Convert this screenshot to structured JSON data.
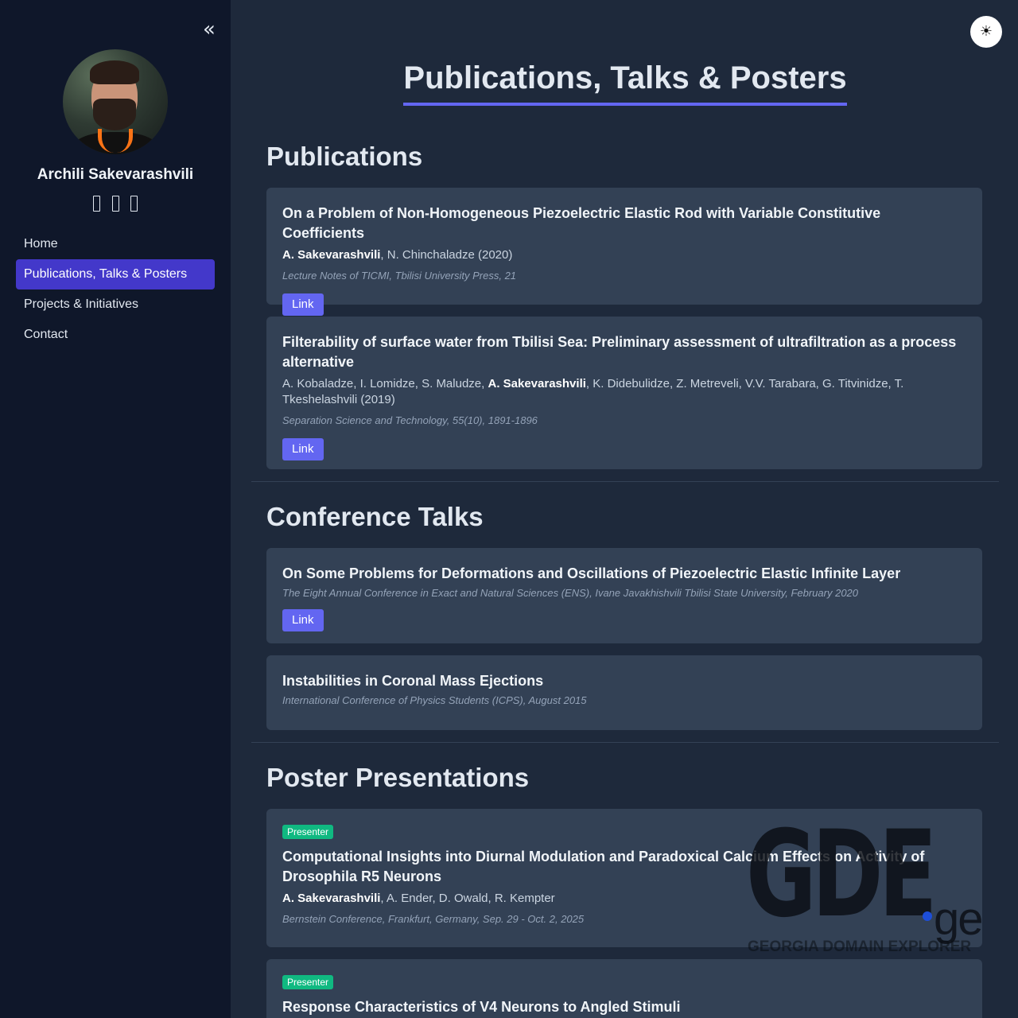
{
  "sidebar": {
    "collapse_icon": "«",
    "name": "Archili Sakevarashvili",
    "nav": [
      {
        "label": "Home",
        "active": false
      },
      {
        "label": "Publications, Talks & Posters",
        "active": true
      },
      {
        "label": "Projects & Initiatives",
        "active": false
      },
      {
        "label": "Contact",
        "active": false
      }
    ]
  },
  "theme_toggle_icon": "☀",
  "page_title": "Publications, Talks & Posters",
  "sections": {
    "publications": {
      "title": "Publications",
      "items": [
        {
          "title": "On a Problem of Non-Homogeneous Piezoelectric Elastic Rod with Variable Constitutive Coefficients",
          "author_bold": "A. Sakevarashvili",
          "authors_rest": ", N. Chinchaladze (2020)",
          "venue": "Lecture Notes of TICMI, Tbilisi University Press, 21",
          "link_label": "Link"
        },
        {
          "title": "Filterability of surface water from Tbilisi Sea: Preliminary assessment of ultrafiltration as a process alternative",
          "authors_before": "A. Kobaladze, I. Lomidze, S. Maludze, ",
          "author_bold": "A. Sakevarashvili",
          "authors_rest": ", K. Didebulidze, Z. Metreveli, V.V. Tarabara, G. Titvinidze, T. Tkeshelashvili (2019)",
          "venue": "Separation Science and Technology, 55(10), 1891-1896",
          "link_label": "Link"
        }
      ]
    },
    "talks": {
      "title": "Conference Talks",
      "items": [
        {
          "title": "On Some Problems for Deformations and Oscillations of Piezoelectric Elastic Infinite Layer",
          "venue": "The Eight Annual Conference in Exact and Natural Sciences (ENS), Ivane Javakhishvili Tbilisi State University, February 2020",
          "link_label": "Link"
        },
        {
          "title": "Instabilities in Coronal Mass Ejections",
          "venue": "International Conference of Physics Students (ICPS), August 2015"
        }
      ]
    },
    "posters": {
      "title": "Poster Presentations",
      "items": [
        {
          "badge": "Presenter",
          "title": "Computational Insights into Diurnal Modulation and Paradoxical Calcium Effects on Activity of Drosophila R5 Neurons",
          "author_bold": "A. Sakevarashvili",
          "authors_rest": ", A. Ender, D. Owald, R. Kempter",
          "venue": "Bernstein Conference, Frankfurt, Germany, Sep. 29 - Oct. 2, 2025"
        },
        {
          "badge": "Presenter",
          "title": "Response Characteristics of V4 Neurons to Angled Stimuli"
        }
      ]
    }
  },
  "watermark": {
    "logo": "GDE",
    "ge": "ge",
    "subtitle": "GEORGIA DOMAIN EXPLORER"
  },
  "colors": {
    "accent": "#6366f1",
    "nav_active": "#4338ca",
    "badge": "#10b981",
    "sidebar_bg": "#0f172a",
    "main_bg": "#1e293b",
    "card_bg": "#334155"
  }
}
